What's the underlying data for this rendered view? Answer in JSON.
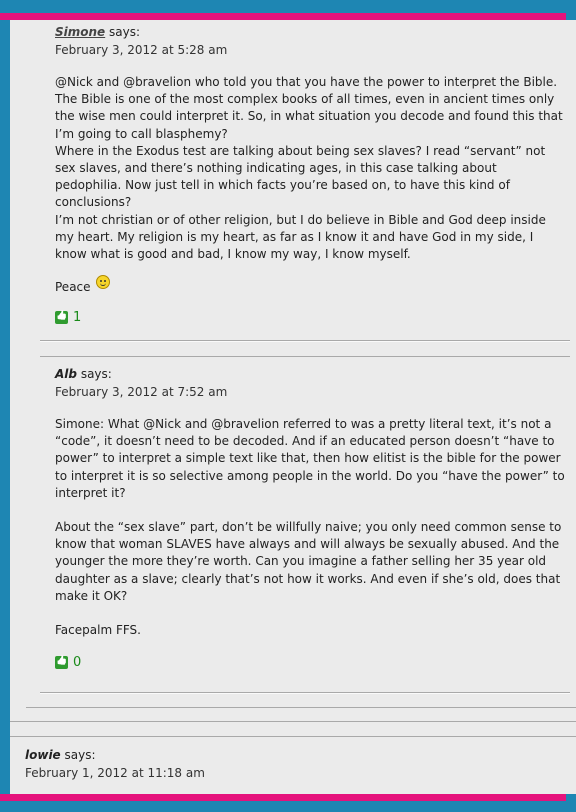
{
  "comments": [
    {
      "author": "Simone",
      "says": "says:",
      "date": "February 3, 2012 at 5:28 am",
      "paragraphs": [
        "@Nick and @bravelion who told you that you have the power to interpret the Bible. The Bible is one of the most complex books of all times, even in ancient times only the wise men could interpret it. So, in what situation you decode and found this that I’m going to call blasphemy?",
        "Where in the Exodus test are talking about being sex slaves? I read “servant” not sex slaves, and there’s nothing indicating ages, in this case talking about pedophilia. Now just tell in which facts you’re based on, to have this kind of conclusions?",
        "I’m not christian or of other religion, but I do believe in Bible and God deep inside my heart. My religion is my heart, as far as I know it and have God in my side, I know what is good and bad, I know my way, I know myself."
      ],
      "closing": "Peace",
      "emoticon": "smiley-icon",
      "likes": "1"
    },
    {
      "author": "Alb",
      "says": "says:",
      "date": "February 3, 2012 at 7:52 am",
      "paragraphs": [
        "Simone: What @Nick and @bravelion referred to was a pretty literal text, it’s not a “code”, it doesn’t need to be decoded. And if an educated person doesn’t “have to power” to interpret a simple text like that, then how elitist is the bible for the power to interpret it is so selective among people in the world. Do you “have the power” to interpret it?",
        "About the “sex slave” part, don’t be willfully naive; you only need common sense to know that woman SLAVES have always and will always be sexually abused. And the younger the more they’re worth. Can you imagine a father selling her 35 year old daughter as a slave; clearly that’s not how it works. And even if she’s old, does that make it OK?",
        "Facepalm FFS."
      ],
      "likes": "0"
    },
    {
      "author": "lowie",
      "says": "says:",
      "date": "February 1, 2012 at 11:18 am"
    }
  ],
  "colors": {
    "background": "#1e86b3",
    "accent_bar": "#e5137c",
    "panel": "#ebebeb",
    "like": "#2f9b2f"
  }
}
